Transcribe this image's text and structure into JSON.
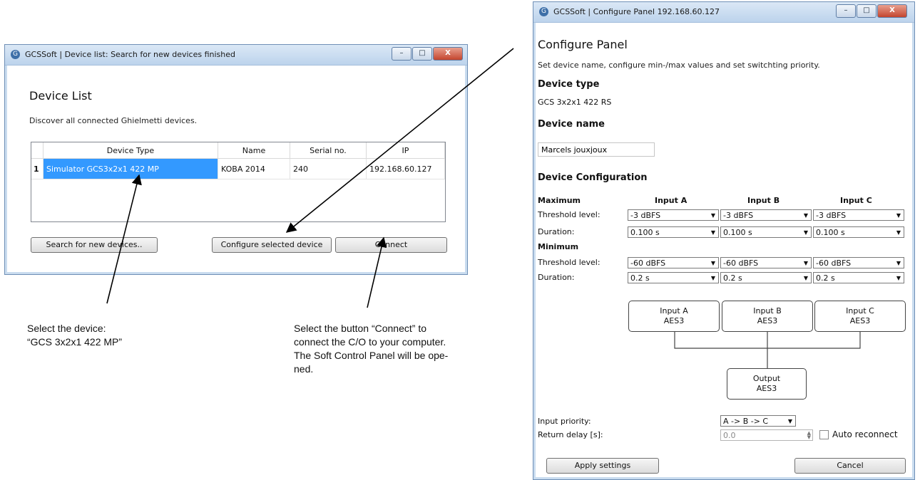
{
  "device_list_window": {
    "title": "GCSSoft | Device list: Search for new devices finished",
    "heading": "Device List",
    "subtitle": "Discover all connected Ghielmetti devices.",
    "columns": [
      "Device Type",
      "Name",
      "Serial no.",
      "IP"
    ],
    "rows": [
      {
        "index": "1",
        "device_type": "Simulator GCS3x2x1 422 MP",
        "name": "KOBA 2014",
        "serial": "240",
        "ip": "192.168.60.127"
      }
    ],
    "buttons": {
      "search": "Search for new devices..",
      "configure": "Configure selected device",
      "connect": "Connect"
    }
  },
  "configure_window": {
    "title": "GCSSoft | Configure Panel 192.168.60.127",
    "heading": "Configure Panel",
    "subtitle": "Set device name, configure min-/max values and set switchting priority.",
    "device_type_label": "Device type",
    "device_type_value": "GCS 3x2x1 422 RS",
    "device_name_label": "Device name",
    "device_name_value": "Marcels jouxjoux",
    "config_label": "Device Configuration",
    "maximum_label": "Maximum",
    "minimum_label": "Minimum",
    "inputs": [
      "Input A",
      "Input B",
      "Input C"
    ],
    "threshold_label": "Threshold level:",
    "duration_label": "Duration:",
    "max_threshold": [
      "-3 dBFS",
      "-3 dBFS",
      "-3 dBFS"
    ],
    "max_duration": [
      "0.100 s",
      "0.100 s",
      "0.100 s"
    ],
    "min_threshold": [
      "-60 dBFS",
      "-60 dBFS",
      "-60 dBFS"
    ],
    "min_duration": [
      "0.2 s",
      "0.2 s",
      "0.2 s"
    ],
    "diagram": {
      "input_a": {
        "name": "Input A",
        "type": "AES3"
      },
      "input_b": {
        "name": "Input B",
        "type": "AES3"
      },
      "input_c": {
        "name": "Input C",
        "type": "AES3"
      },
      "output": {
        "name": "Output",
        "type": "AES3"
      }
    },
    "input_priority_label": "Input priority:",
    "input_priority_value": "A -> B -> C",
    "return_delay_label": "Return delay [s]:",
    "return_delay_value": "0.0",
    "auto_reconnect_label": "Auto reconnect",
    "apply_button": "Apply settings",
    "cancel_button": "Cancel"
  },
  "annotations": {
    "select_device_line1": "Select the device:",
    "select_device_line2": "“GCS 3x2x1 422 MP”",
    "connect_line1": "Select  the button “Connect” to",
    "connect_line2": "connect the C/O to your computer.",
    "connect_line3": "The Soft Control Panel will be ope-",
    "connect_line4": "ned."
  },
  "icons": {
    "app": "gcssoft-logo-icon",
    "dropdown": "chevron-down-icon"
  }
}
